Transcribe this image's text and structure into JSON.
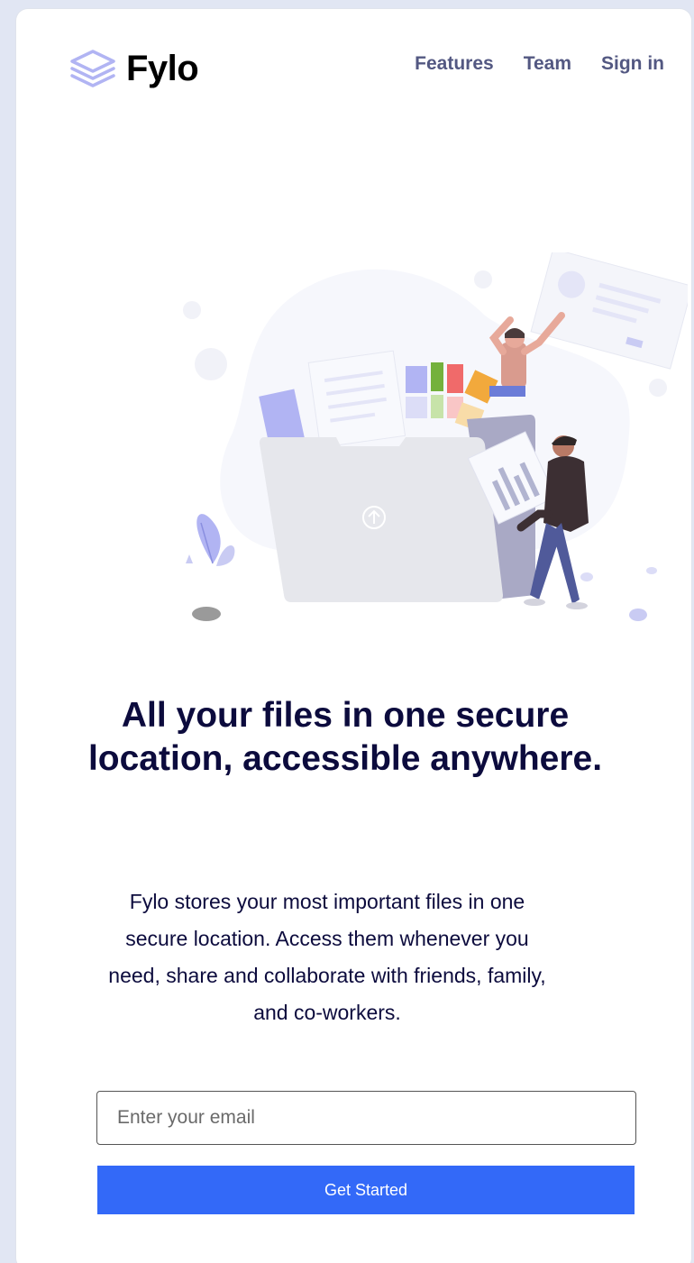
{
  "brand": {
    "name": "Fylo",
    "logo_icon": "layers-stack-icon",
    "logo_color": "#b1b4f3"
  },
  "nav": {
    "items": [
      "Features",
      "Team",
      "Sign in"
    ]
  },
  "hero": {
    "illustration_icon": "file-sharing-illustration",
    "headline": "All your files in one secure location, accessible anywhere.",
    "description": "Fylo stores your most important files in one secure location. Access them whenever you need, share and collaborate with friends, family, and co-workers."
  },
  "form": {
    "email_placeholder": "Enter your email",
    "submit_label": "Get Started"
  },
  "colors": {
    "accent": "#3369f8",
    "headline": "#0c0b3d",
    "nav_text": "#535882",
    "page_bg": "#e1e6f3"
  }
}
